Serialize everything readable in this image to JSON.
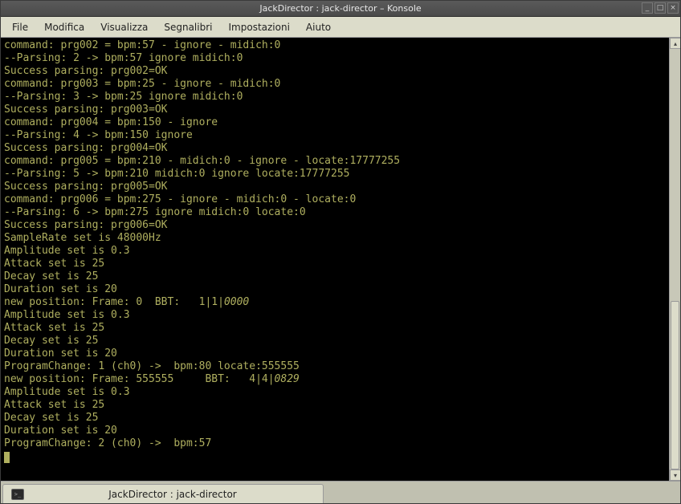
{
  "titlebar": {
    "title": "JackDirector : jack-director – Konsole",
    "minimize": "_",
    "maximize": "□",
    "close": "×"
  },
  "menubar": {
    "file": "File",
    "edit": "Modifica",
    "view": "Visualizza",
    "bookmarks": "Segnalibri",
    "settings": "Impostazioni",
    "help": "Aiuto"
  },
  "terminal": {
    "lines": [
      "command: prg002 = bpm:57 - ignore - midich:0",
      "--Parsing: 2 -> bpm:57 ignore midich:0",
      "Success parsing: prg002=OK",
      "command: prg003 = bpm:25 - ignore - midich:0",
      "--Parsing: 3 -> bpm:25 ignore midich:0",
      "Success parsing: prg003=OK",
      "command: prg004 = bpm:150 - ignore",
      "--Parsing: 4 -> bpm:150 ignore",
      "Success parsing: prg004=OK",
      "command: prg005 = bpm:210 - midich:0 - ignore - locate:17777255",
      "--Parsing: 5 -> bpm:210 midich:0 ignore locate:17777255",
      "Success parsing: prg005=OK",
      "command: prg006 = bpm:275 - ignore - midich:0 - locate:0",
      "--Parsing: 6 -> bpm:275 ignore midich:0 locate:0",
      "Success parsing: prg006=OK",
      "SampleRate set is 48000Hz",
      "Amplitude set is 0.3",
      "Attack set is 25",
      "Decay set is 25",
      "Duration set is 20"
    ],
    "line_pos_a": "new position: Frame: 0  BBT:   1|1|",
    "line_pos_a_italic": "0000",
    "lines2": [
      "Amplitude set is 0.3",
      "Attack set is 25",
      "Decay set is 25",
      "Duration set is 20",
      "ProgramChange: 1 (ch0) ->  bpm:80 locate:555555"
    ],
    "line_pos_b": "new position: Frame: 555555     BBT:   4|4|",
    "line_pos_b_italic": "0829",
    "lines3": [
      "Amplitude set is 0.3",
      "Attack set is 25",
      "Decay set is 25",
      "Duration set is 20",
      "ProgramChange: 2 (ch0) ->  bpm:57"
    ]
  },
  "scrollbar": {
    "up": "▴",
    "down": "▾"
  },
  "tab": {
    "label": "JackDirector : jack-director"
  }
}
